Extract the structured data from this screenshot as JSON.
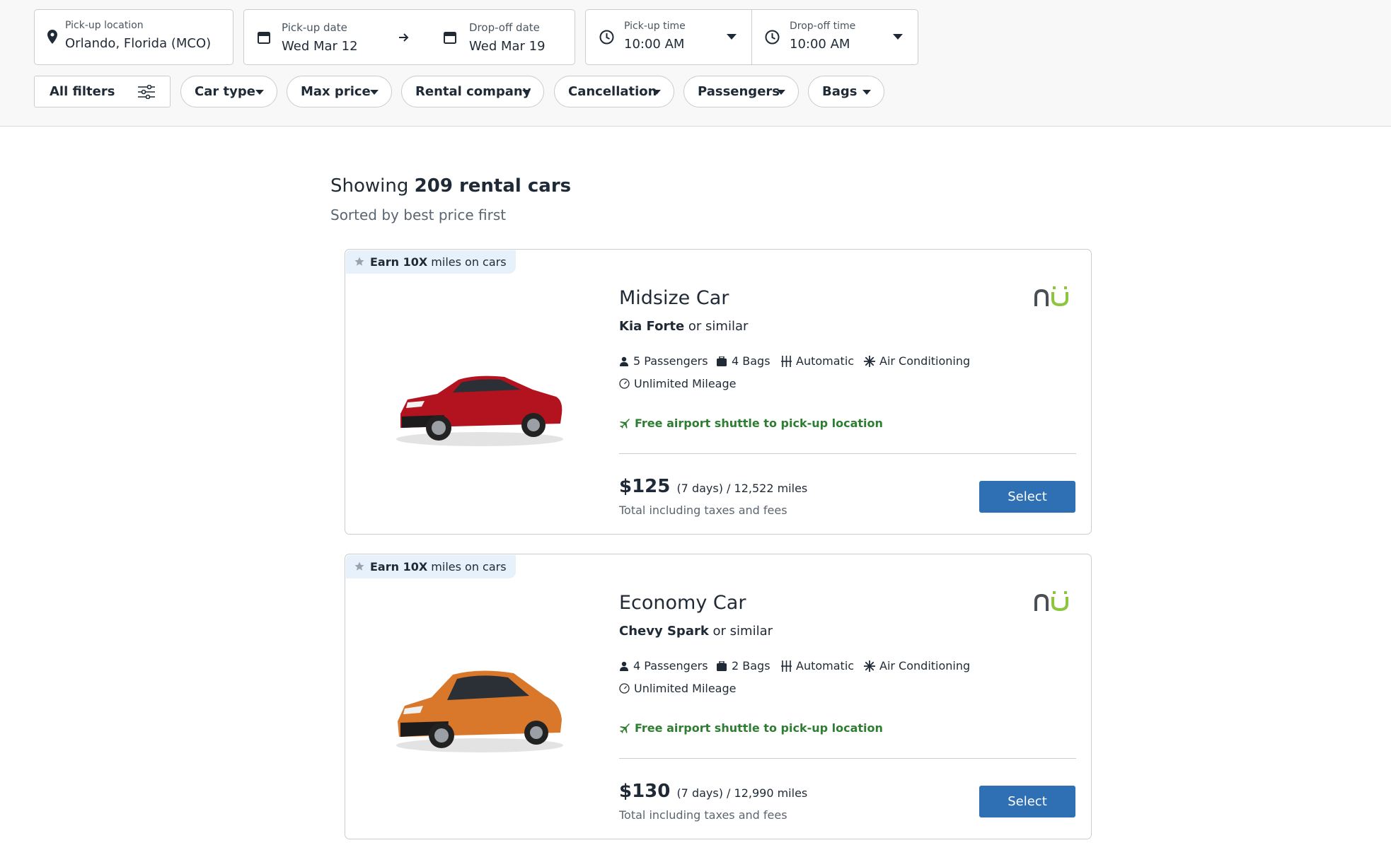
{
  "search": {
    "pickup_location_label": "Pick-up location",
    "pickup_location_value": "Orlando, Florida (MCO)",
    "pickup_date_label": "Pick-up date",
    "pickup_date_value": "Wed Mar 12",
    "dropoff_date_label": "Drop-off date",
    "dropoff_date_value": "Wed Mar 19",
    "pickup_time_label": "Pick-up time",
    "pickup_time_value": "10:00 AM",
    "dropoff_time_label": "Drop-off time",
    "dropoff_time_value": "10:00 AM"
  },
  "filters": {
    "all_filters": "All filters",
    "chips": [
      "Car type",
      "Max price",
      "Rental company",
      "Cancellation",
      "Passengers",
      "Bags"
    ]
  },
  "results": {
    "showing_prefix": "Showing",
    "count_text": "209 rental cars",
    "sort_text": "Sorted by best price first"
  },
  "cards": [
    {
      "badge_bold": "Earn 10X",
      "badge_rest": "miles on cars",
      "title": "Midsize Car",
      "model": "Kia Forte",
      "model_suffix": "or similar",
      "passengers": "5 Passengers",
      "bags": "4 Bags",
      "transmission": "Automatic",
      "ac": "Air Conditioning",
      "mileage": "Unlimited Mileage",
      "shuttle": "Free airport shuttle to pick-up location",
      "price": "$125",
      "price_extra": "(7 days) / 12,522 miles",
      "total": "Total including taxes and fees",
      "select": "Select",
      "car_color": "#b3121f"
    },
    {
      "badge_bold": "Earn 10X",
      "badge_rest": "miles on cars",
      "title": "Economy Car",
      "model": "Chevy Spark",
      "model_suffix": "or similar",
      "passengers": "4 Passengers",
      "bags": "2 Bags",
      "transmission": "Automatic",
      "ac": "Air Conditioning",
      "mileage": "Unlimited Mileage",
      "shuttle": "Free airport shuttle to pick-up location",
      "price": "$130",
      "price_extra": "(7 days) / 12,990 miles",
      "total": "Total including taxes and fees",
      "select": "Select",
      "car_color": "#d9772b"
    }
  ],
  "colors": {
    "accent": "#2f6fb3",
    "shuttle_green": "#2e7d32",
    "badge_bg": "#e6f1fb",
    "logo_green": "#8cc63f",
    "logo_dark": "#4a4f55"
  },
  "icons": [
    "location-pin-icon",
    "calendar-icon",
    "arrow-right-icon",
    "clock-icon",
    "chevron-down-icon",
    "sliders-icon",
    "star-icon",
    "person-icon",
    "luggage-icon",
    "transmission-icon",
    "snowflake-icon",
    "speedometer-icon",
    "airplane-icon"
  ]
}
